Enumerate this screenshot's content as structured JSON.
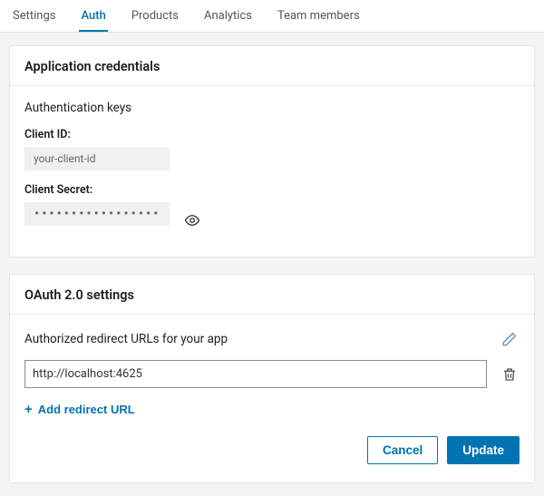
{
  "tabs": {
    "settings": "Settings",
    "auth": "Auth",
    "products": "Products",
    "analytics": "Analytics",
    "team_members": "Team members",
    "active": "auth"
  },
  "credentials": {
    "card_title": "Application credentials",
    "auth_keys_heading": "Authentication keys",
    "client_id_label": "Client ID:",
    "client_id_value": "your-client-id",
    "client_secret_label": "Client Secret:",
    "client_secret_masked": "•••••••••••••••••",
    "reveal_icon": "eye-icon"
  },
  "oauth": {
    "card_title": "OAuth 2.0 settings",
    "redirect_heading": "Authorized redirect URLs for your app",
    "edit_icon": "pencil-icon",
    "urls": [
      {
        "value": "http://localhost:4625",
        "delete_icon": "trash-icon"
      }
    ],
    "add_url_label": "Add redirect URL",
    "cancel_label": "Cancel",
    "update_label": "Update"
  }
}
